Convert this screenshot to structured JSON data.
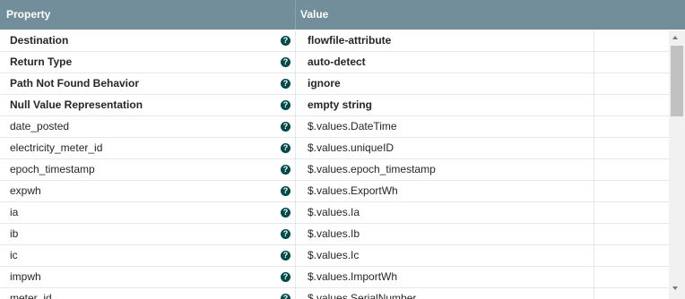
{
  "header": {
    "property_label": "Property",
    "value_label": "Value"
  },
  "rows": [
    {
      "property": "Destination",
      "value": "flowfile-attribute",
      "bold": true
    },
    {
      "property": "Return Type",
      "value": "auto-detect",
      "bold": true
    },
    {
      "property": "Path Not Found Behavior",
      "value": "ignore",
      "bold": true
    },
    {
      "property": "Null Value Representation",
      "value": "empty string",
      "bold": true
    },
    {
      "property": "date_posted",
      "value": "$.values.DateTime",
      "bold": false
    },
    {
      "property": "electricity_meter_id",
      "value": "$.values.uniqueID",
      "bold": false
    },
    {
      "property": "epoch_timestamp",
      "value": "$.values.epoch_timestamp",
      "bold": false
    },
    {
      "property": "expwh",
      "value": "$.values.ExportWh",
      "bold": false
    },
    {
      "property": "ia",
      "value": "$.values.Ia",
      "bold": false
    },
    {
      "property": "ib",
      "value": "$.values.Ib",
      "bold": false
    },
    {
      "property": "ic",
      "value": "$.values.Ic",
      "bold": false
    },
    {
      "property": "impwh",
      "value": "$.values.ImportWh",
      "bold": false
    },
    {
      "property": "meter_id",
      "value": "$.values.SerialNumber",
      "bold": false
    }
  ],
  "help_icon": "help-icon",
  "colors": {
    "header_bg": "#728e9b",
    "help_icon_bg": "#004849"
  }
}
